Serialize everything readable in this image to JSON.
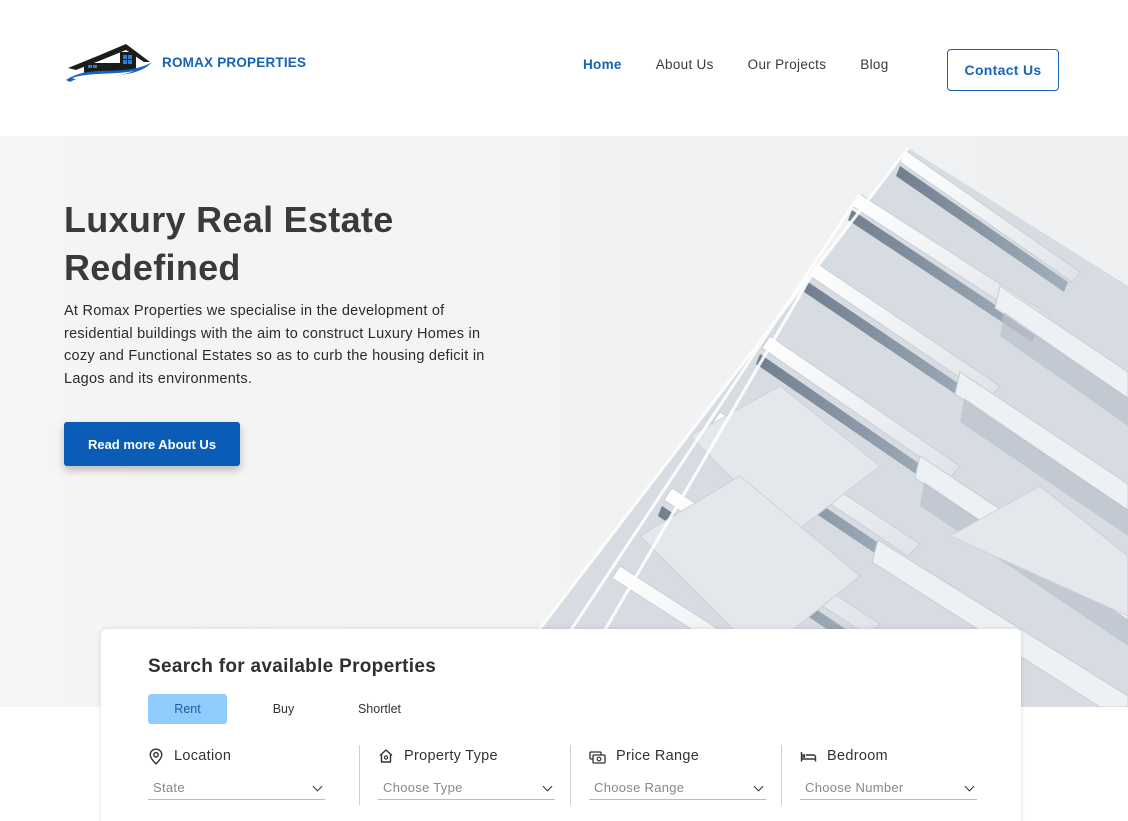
{
  "brand": {
    "name": "ROMAX PROPERTIES",
    "primary_color": "#1463b3",
    "button_color": "#0b5cb6",
    "tab_active_color": "#91cbfb"
  },
  "nav": {
    "items": [
      {
        "label": "Home",
        "active": true
      },
      {
        "label": "About Us",
        "active": false
      },
      {
        "label": "Our Projects",
        "active": false
      },
      {
        "label": "Blog",
        "active": false
      }
    ],
    "contact_label": "Contact Us"
  },
  "hero": {
    "title": "Luxury Real Estate Redefined",
    "description": "At Romax Properties we specialise in the development of residential buildings with the aim to construct Luxury Homes in cozy and Functional Estates so as to curb the housing deficit in Lagos and its environments.",
    "cta_label": "Read more About Us"
  },
  "search": {
    "title": "Search for available Properties",
    "tabs": [
      {
        "label": "Rent",
        "active": true
      },
      {
        "label": "Buy",
        "active": false
      },
      {
        "label": "Shortlet",
        "active": false
      }
    ],
    "fields": [
      {
        "label": "Location",
        "placeholder": "State",
        "icon": "location-pin-icon"
      },
      {
        "label": "Property Type",
        "placeholder": "Choose Type",
        "icon": "house-icon"
      },
      {
        "label": "Price Range",
        "placeholder": "Choose Range",
        "icon": "money-icon"
      },
      {
        "label": "Bedroom",
        "placeholder": "Choose Number",
        "icon": "bed-icon"
      }
    ]
  }
}
